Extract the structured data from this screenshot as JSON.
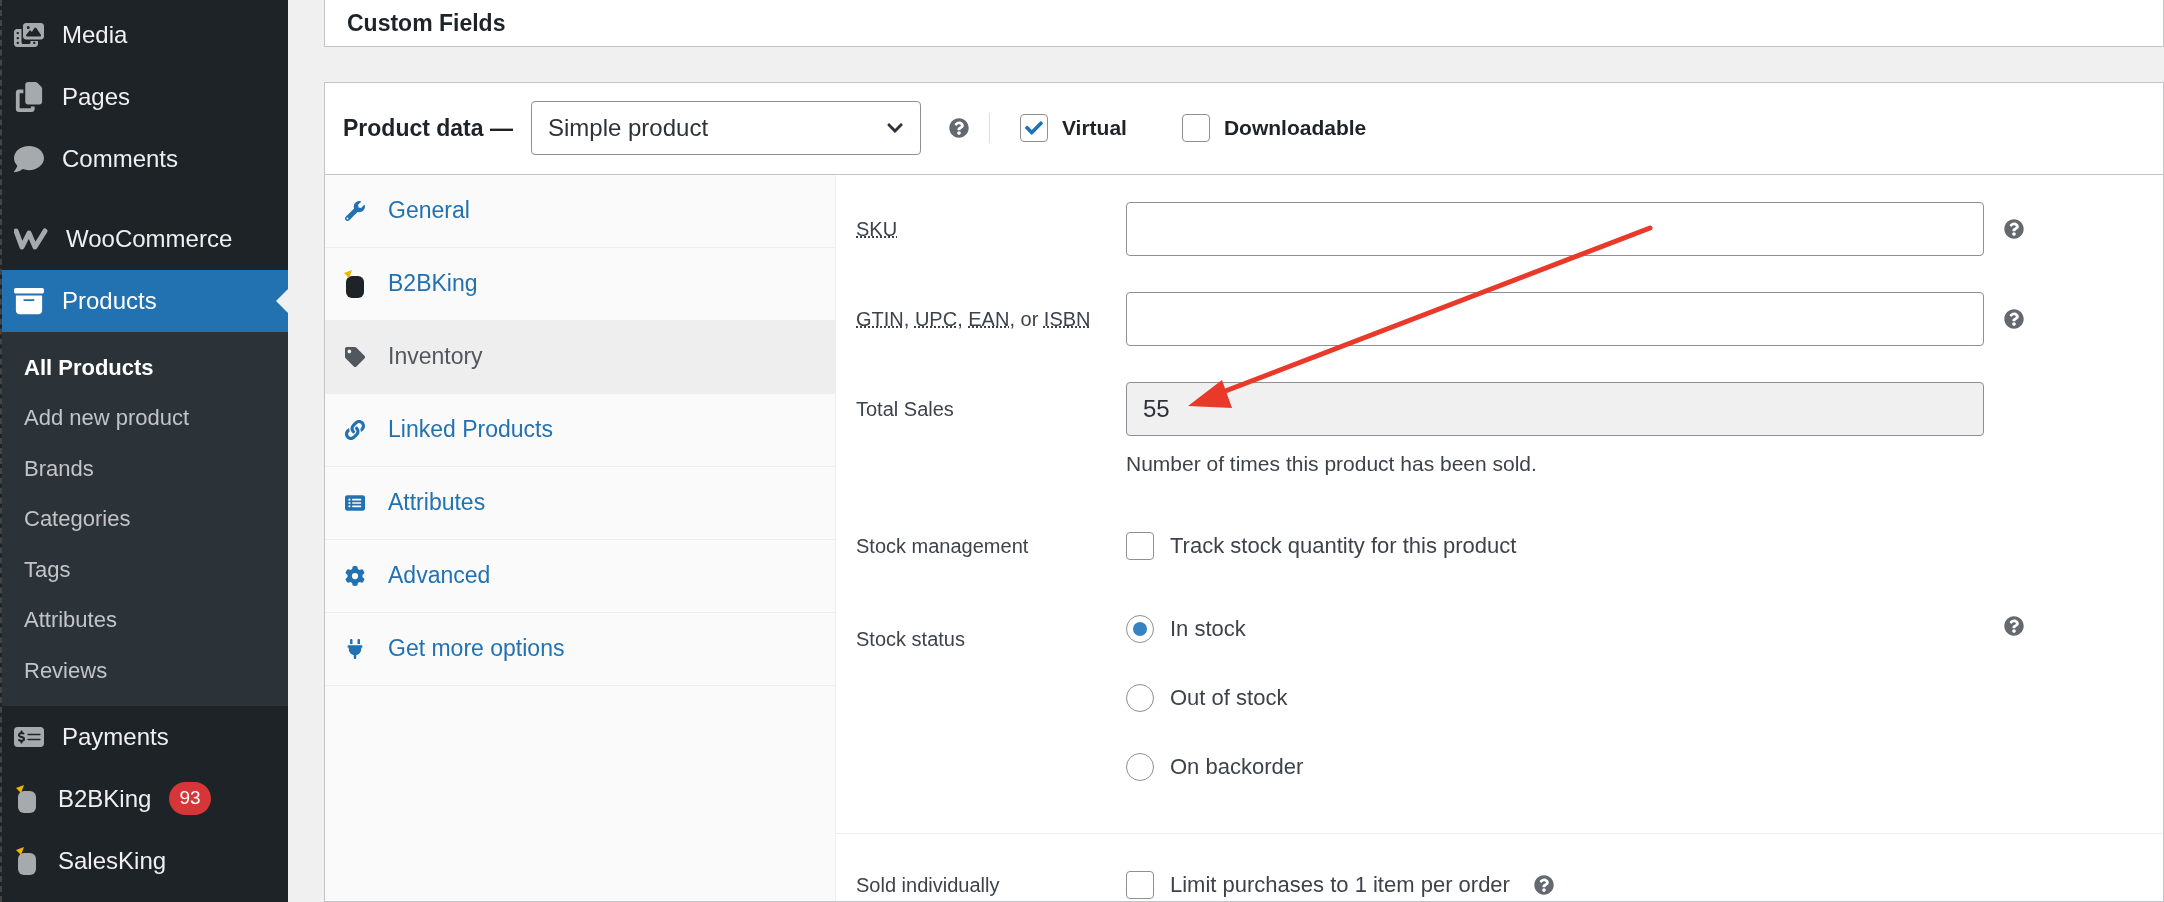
{
  "sidebar": {
    "items": [
      {
        "label": "Media",
        "selected": false
      },
      {
        "label": "Pages",
        "selected": false
      },
      {
        "label": "Comments",
        "selected": false
      },
      {
        "label": "WooCommerce",
        "selected": false
      },
      {
        "label": "Products",
        "selected": true,
        "children": [
          {
            "label": "All Products",
            "selected": true
          },
          {
            "label": "Add new product",
            "selected": false
          },
          {
            "label": "Brands",
            "selected": false
          },
          {
            "label": "Categories",
            "selected": false
          },
          {
            "label": "Tags",
            "selected": false
          },
          {
            "label": "Attributes",
            "selected": false
          },
          {
            "label": "Reviews",
            "selected": false
          }
        ]
      },
      {
        "label": "Payments",
        "selected": false
      },
      {
        "label": "B2BKing",
        "selected": false,
        "badge": "93"
      },
      {
        "label": "SalesKing",
        "selected": false
      }
    ]
  },
  "custom_fields": {
    "title": "Custom Fields"
  },
  "product_data": {
    "title": "Product data —",
    "product_type": "Simple product",
    "virtual": {
      "label": "Virtual",
      "checked": true
    },
    "downloadable": {
      "label": "Downloadable",
      "checked": false
    },
    "tabs": [
      {
        "label": "General",
        "selected": false
      },
      {
        "label": "B2BKing",
        "selected": false
      },
      {
        "label": "Inventory",
        "selected": true
      },
      {
        "label": "Linked Products",
        "selected": false
      },
      {
        "label": "Attributes",
        "selected": false
      },
      {
        "label": "Advanced",
        "selected": false
      },
      {
        "label": "Get more options",
        "selected": false
      }
    ],
    "sections": [
      {
        "rows": [
          {
            "kind": "text",
            "label_parts": [
              {
                "text": "SKU",
                "abbr": true
              }
            ],
            "help": true
          },
          {
            "kind": "text",
            "label_parts": [
              {
                "text": "GTIN",
                "abbr": true
              },
              {
                "text": ", ",
                "abbr": false
              },
              {
                "text": "UPC",
                "abbr": true
              },
              {
                "text": ", ",
                "abbr": false
              },
              {
                "text": "EAN",
                "abbr": true
              },
              {
                "text": ", or ",
                "abbr": false
              },
              {
                "text": "ISBN",
                "abbr": true
              }
            ],
            "help": true
          },
          {
            "kind": "readonly",
            "label": "Total Sales",
            "value": "55",
            "description": "Number of times this product has been sold.",
            "help": false
          },
          {
            "kind": "checkbox",
            "label": "Stock management",
            "option": "Track stock quantity for this product",
            "checked": false,
            "help": false
          },
          {
            "kind": "radio",
            "label": "Stock status",
            "options": [
              {
                "label": "In stock",
                "selected": true
              },
              {
                "label": "Out of stock",
                "selected": false
              },
              {
                "label": "On backorder",
                "selected": false
              }
            ],
            "help": true
          }
        ]
      },
      {
        "rows": [
          {
            "kind": "checkbox",
            "label": "Sold individually",
            "option": "Limit purchases to 1 item per order",
            "checked": false,
            "help": true
          }
        ]
      }
    ]
  }
}
